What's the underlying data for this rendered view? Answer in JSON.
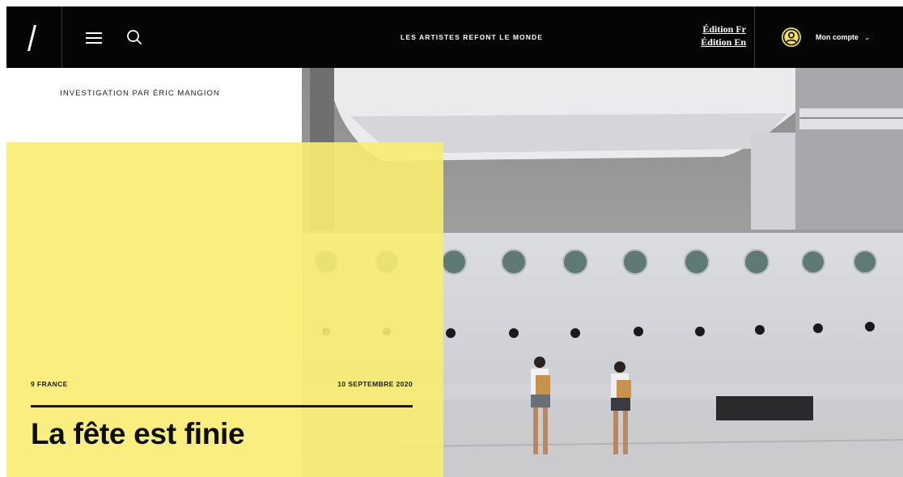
{
  "header": {
    "tagline": "LES ARTISTES REFONT LE MONDE",
    "editions": [
      "Édition Fr",
      "Édition En"
    ],
    "account_label": "Mon compte"
  },
  "article": {
    "author": "INVESTIGATION PAR ÉRIC MANGION",
    "location": "9 FRANCE",
    "date": "10 SEPTEMBRE 2020",
    "title": "La fête est finie"
  },
  "icons": {
    "logo": "slash-logo-icon",
    "menu": "hamburger-menu-icon",
    "search": "search-icon",
    "account": "user-avatar-icon",
    "dropdown": "chevron-down-icon"
  },
  "colors": {
    "header_bg": "#050505",
    "accent_yellow": "#f8ec70",
    "text_dark": "#0c0c0c"
  }
}
